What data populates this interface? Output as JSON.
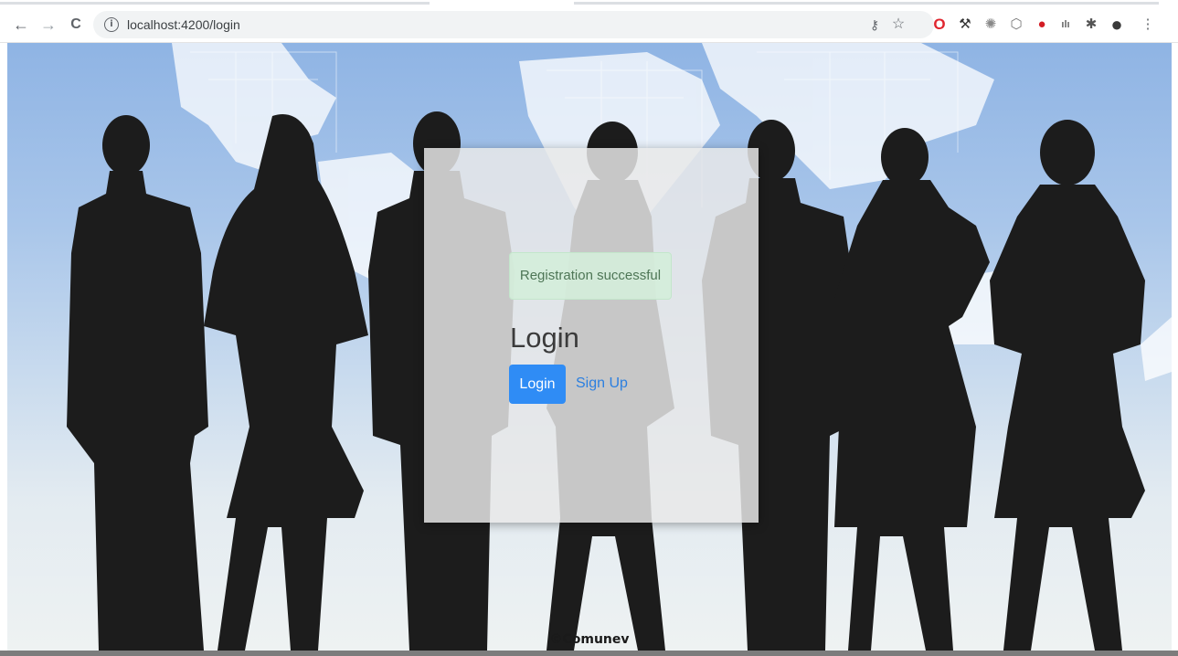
{
  "browser": {
    "url": "localhost:4200/login",
    "nav_icons": {
      "back": "←",
      "forward": "→",
      "reload": "C"
    },
    "info_icon": "i",
    "omnibox_icons": {
      "key": "⚷",
      "star": "☆"
    },
    "extensions": [
      {
        "name": "opera-icon",
        "glyph": "O",
        "color": "#e0262f"
      },
      {
        "name": "hammer-icon",
        "glyph": "⚒",
        "color": "#333333"
      },
      {
        "name": "bee-icon",
        "glyph": "✺",
        "color": "#888888"
      },
      {
        "name": "shield-icon",
        "glyph": "⬡",
        "color": "#777777"
      },
      {
        "name": "red-circle-icon",
        "glyph": "●",
        "color": "#d31d25"
      },
      {
        "name": "chart-icon",
        "glyph": "ılı",
        "color": "#666666"
      },
      {
        "name": "puzzle-icon",
        "glyph": "✱",
        "color": "#555555"
      },
      {
        "name": "profile-avatar-icon",
        "glyph": "●",
        "color": "#3a3a3a"
      },
      {
        "name": "kebab-menu-icon",
        "glyph": "⋮",
        "color": "#5f6368"
      }
    ]
  },
  "page": {
    "alert": "Registration successful",
    "title": "Login",
    "login_button": "Login",
    "signup_link": "Sign Up",
    "footer": "©Comunev"
  },
  "colors": {
    "primary": "#2f8cf5",
    "link": "#2b7fe0",
    "alert_bg": "#d4edda",
    "alert_text": "#4e7656",
    "silhouette": "#1c1c1c",
    "sky_top": "#8fb4e4"
  }
}
